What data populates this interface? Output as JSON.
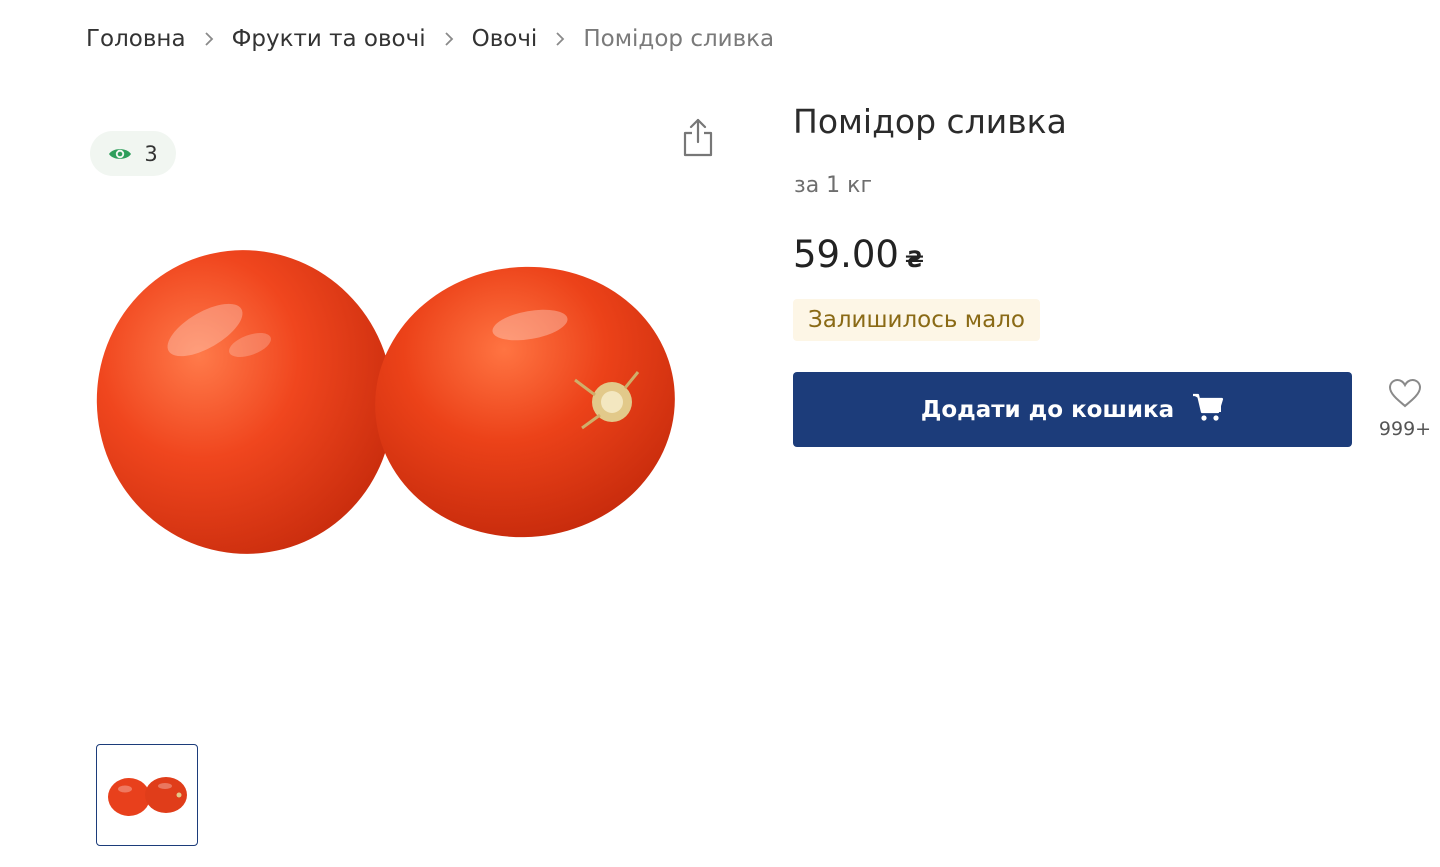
{
  "breadcrumb": {
    "items": [
      "Головна",
      "Фрукти та овочі",
      "Овочі"
    ],
    "current": "Помідор сливка"
  },
  "gallery": {
    "views_count": "3",
    "icons": {
      "views": "eye-icon",
      "share": "share-icon"
    }
  },
  "product": {
    "title": "Помідор сливка",
    "unit": "за 1 кг",
    "price": "59.00",
    "currency": "₴",
    "stock_status": "Залишилось мало"
  },
  "actions": {
    "add_to_cart_label": "Додати до кошика",
    "wishlist_count": "999+"
  },
  "colors": {
    "primary": "#1c3c7a",
    "stock_badge_bg": "#fdf6e6",
    "stock_badge_text": "#8a6a16",
    "views_badge_bg": "#f1f6f1",
    "eye_icon": "#2e9e5b",
    "tomato": "#e8401c"
  }
}
